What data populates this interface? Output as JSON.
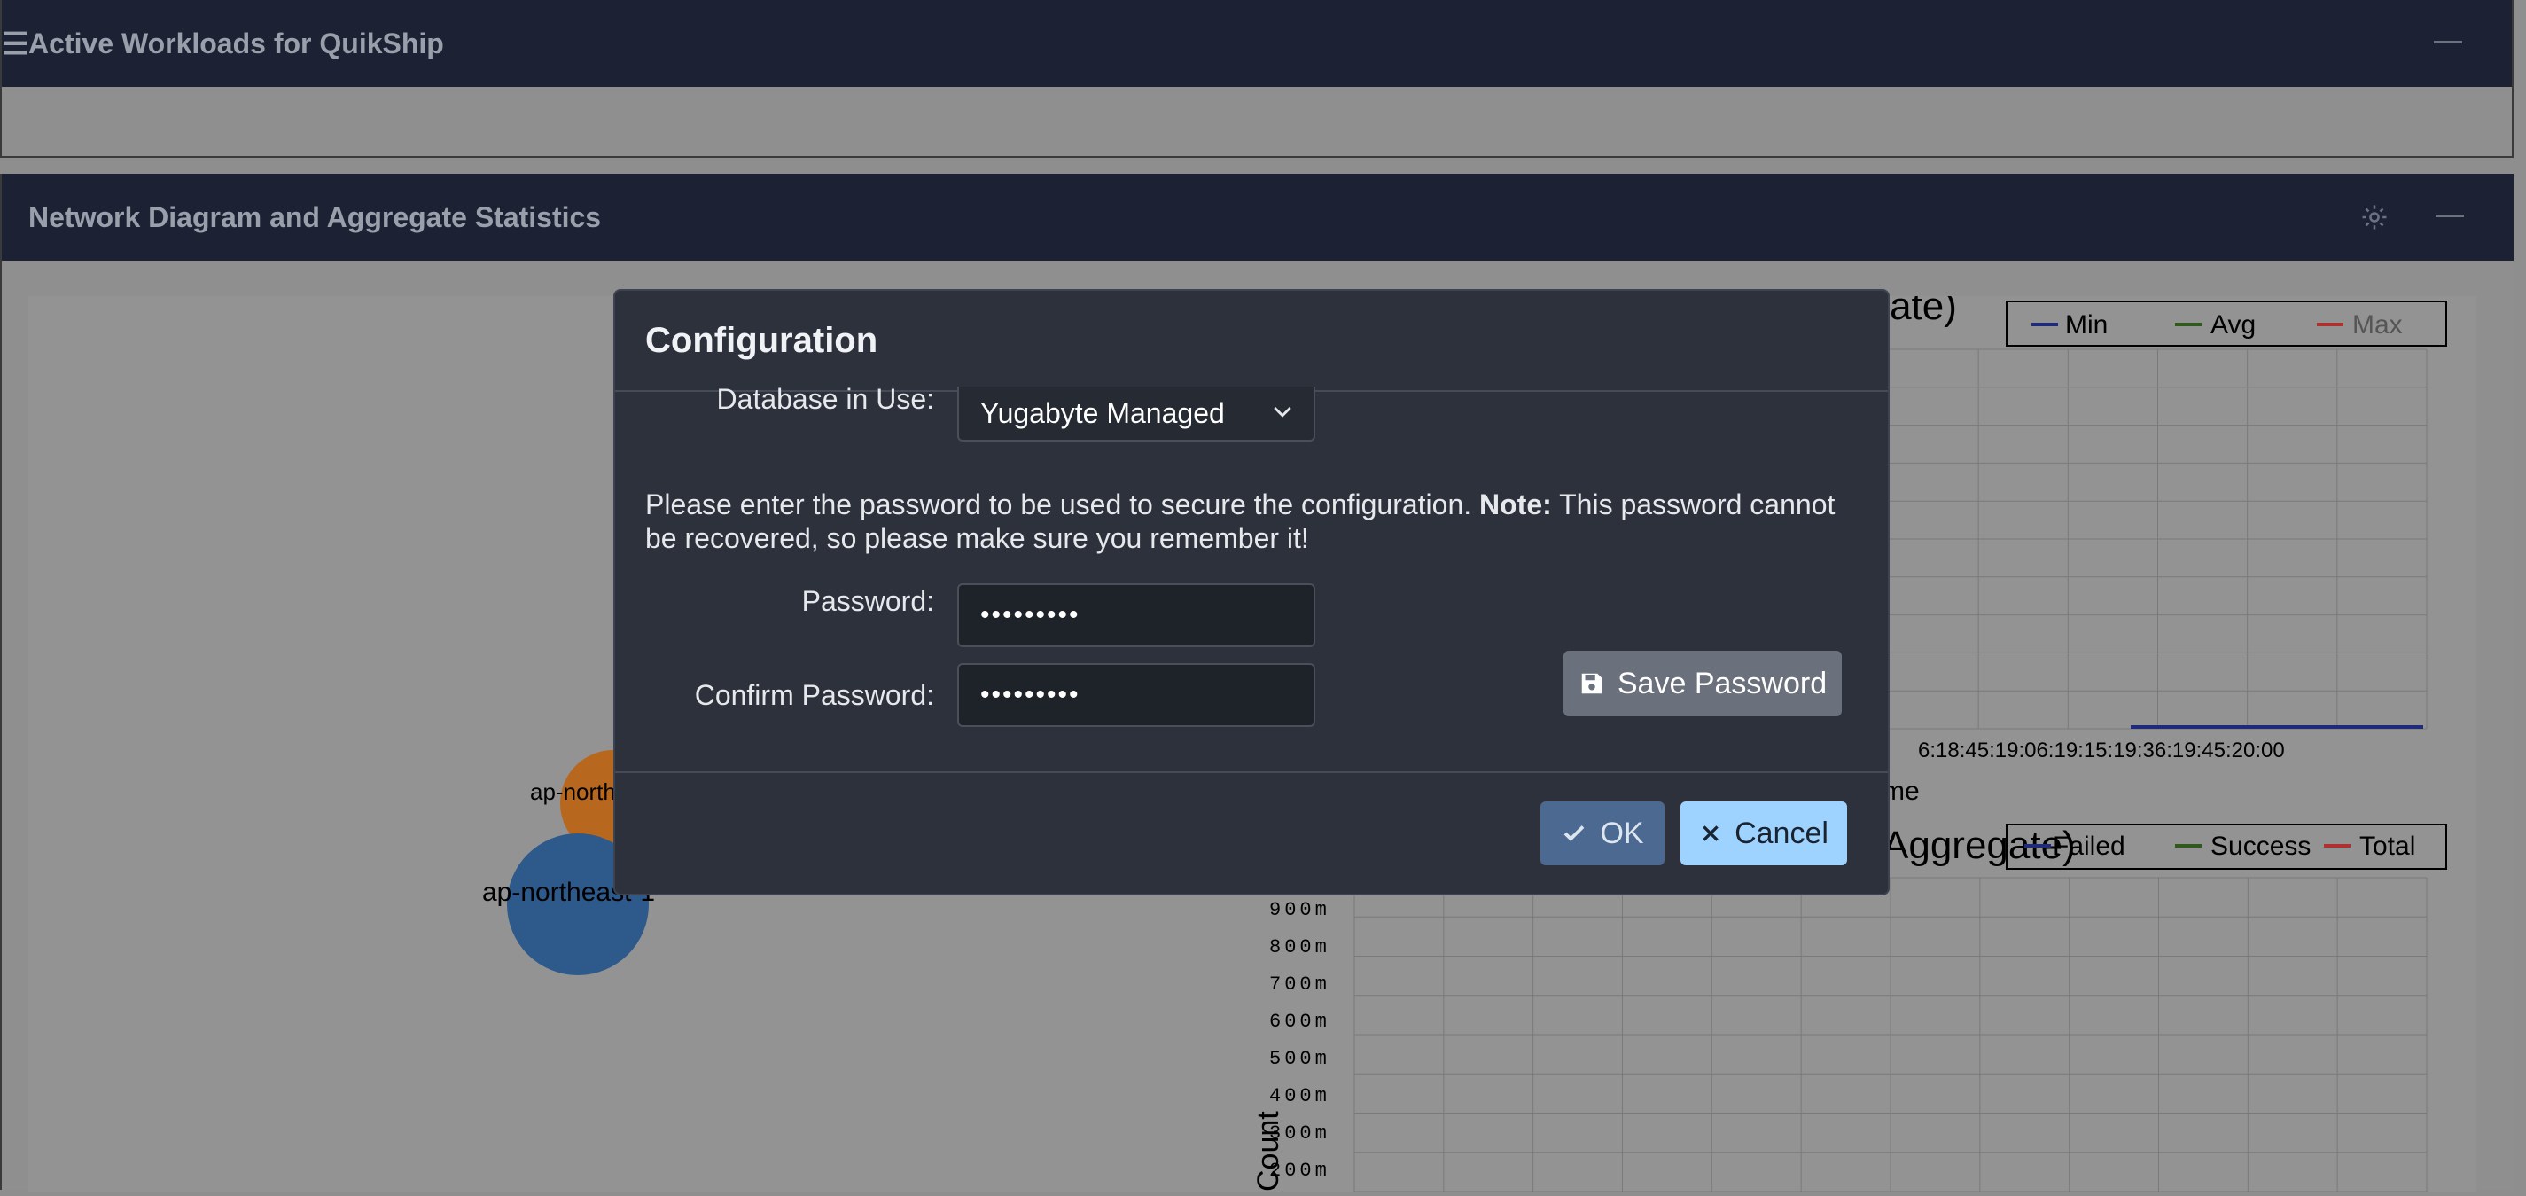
{
  "panels": {
    "workloads": {
      "menu_glyph": "☰",
      "title": "Active Workloads for QuikShip"
    },
    "network": {
      "title": "Network Diagram and Aggregate Statistics"
    }
  },
  "network_nodes": {
    "node_orange_label": "ap-north",
    "node_blue_label": "ap-northeast-1"
  },
  "background_charts": {
    "latency": {
      "title_fragment": "gregate)",
      "legend": [
        "Min",
        "Avg",
        "Max"
      ],
      "x_ticks_fragment": "6:18:45:19:06:19:15:19:36:19:45:20:00",
      "xlabel_fragment": "me"
    },
    "count": {
      "title_fragment": "Aggregate)",
      "legend": [
        "Failed",
        "Success",
        "Total"
      ],
      "y_ticks": [
        "900m",
        "800m",
        "700m",
        "600m",
        "500m",
        "400m",
        "300m",
        "200m"
      ],
      "ylabel": "Count"
    }
  },
  "modal": {
    "title": "Configuration",
    "database_label": "Database in Use:",
    "database_value": "Yugabyte Managed",
    "note_text": "Please enter the password to be used to secure the configuration.",
    "note_bold": "Note:",
    "note_rest": "This password cannot be recovered, so please make sure you remember it!",
    "password_label": "Password:",
    "password_value": "•••••••••",
    "confirm_label": "Confirm Password:",
    "confirm_value": "•••••••••",
    "save_label": "Save Password",
    "ok_label": "OK",
    "cancel_label": "Cancel"
  },
  "colors": {
    "header_bg": "#1c2233",
    "modal_bg": "#2c313c",
    "ok_bg": "#4c6a91",
    "cancel_bg": "#9fd3ff",
    "save_bg": "#6b717c",
    "node_orange": "#b8671f",
    "node_blue": "#2d5a8a",
    "series_min": "#1f2a7a",
    "series_avg": "#2f5a1c",
    "series_max": "#b03030"
  }
}
